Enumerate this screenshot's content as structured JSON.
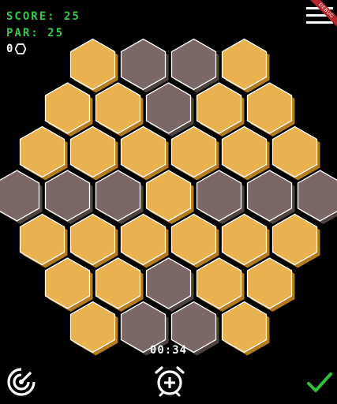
{
  "hud": {
    "score_label": "SCORE:",
    "score_value": "25",
    "par_label": "PAR:",
    "par_value": "25",
    "moves_count": "0",
    "timer": "00:34"
  },
  "debug_banner": "DEBUG",
  "board": {
    "tiles": [
      [
        "active",
        "inactive",
        "inactive",
        "active"
      ],
      [
        "active",
        "active",
        "inactive",
        "active",
        "active"
      ],
      [
        "active",
        "active",
        "active",
        "active",
        "active",
        "active"
      ],
      [
        "inactive",
        "inactive",
        "inactive",
        "active",
        "inactive",
        "inactive",
        "inactive"
      ],
      [
        "active",
        "active",
        "active",
        "active",
        "active",
        "active"
      ],
      [
        "active",
        "active",
        "inactive",
        "active",
        "active"
      ],
      [
        "active",
        "inactive",
        "inactive",
        "active"
      ]
    ]
  },
  "icons": {
    "menu": "hamburger-menu-icon",
    "restart": "radar-restart-icon",
    "add_time": "alarm-clock-plus-icon",
    "confirm": "checkmark-icon",
    "moves": "hexagon-outline-icon"
  },
  "colors": {
    "background": "#000000",
    "hud_text": "#37c94a",
    "tile_active": "#eab24f",
    "tile_active_shadow": "#b47a1e",
    "tile_inactive": "#7b6866",
    "tile_inactive_shadow": "#4e4240",
    "tile_outline": "#ffffff",
    "confirm": "#2fbf3c",
    "icon": "#ffffff",
    "debug_ribbon": "#b3262b"
  }
}
